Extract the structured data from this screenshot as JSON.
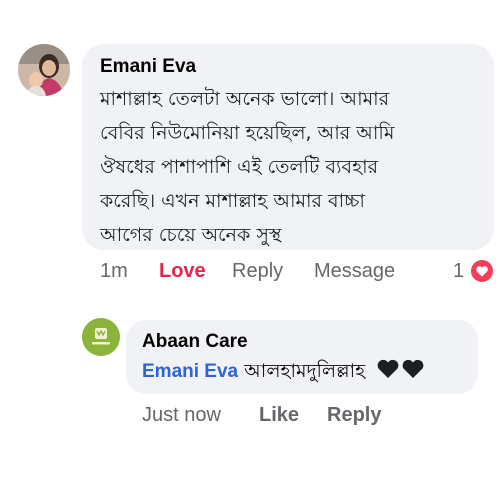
{
  "comment": {
    "avatar_icon": "user-avatar-photo",
    "author": "Emani Eva",
    "lines": [
      "মাশাল্লাহ তেলটা অনেক ভালো। আমার",
      "বেবির নিউমোনিয়া হয়েছিল, আর আমি",
      "ঔষধের  পাশাপাশি এই তেলটি ব্যবহার",
      "করেছি। এখন মাশাল্লাহ আমার বাচ্চা",
      "আগের চেয়ে অনেক সুস্থ"
    ],
    "actions": {
      "time": "1m",
      "love": "Love",
      "reply": "Reply",
      "message": "Message",
      "reaction_count": "1",
      "reaction_icon": "heart-reaction-icon"
    }
  },
  "reply": {
    "avatar_icon": "abaan-care-logo",
    "author": "Abaan Care",
    "mention": "Emani Eva",
    "text": "আলহামদুলিল্লাহ",
    "emoji": "black-hearts-emoji",
    "actions": {
      "time": "Just now",
      "like": "Like",
      "reply": "Reply"
    }
  },
  "colors": {
    "bubble": "#f0f2f5",
    "love": "#e4254b",
    "mention": "#2e64d4",
    "muted": "#65676b"
  }
}
